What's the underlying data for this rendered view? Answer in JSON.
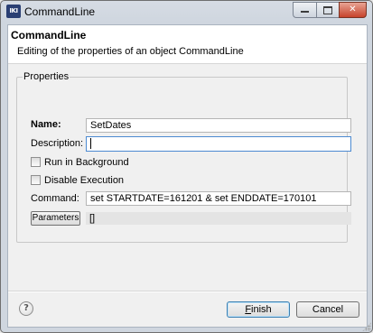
{
  "window": {
    "title": "CommandLine",
    "app_icon_text": "IKI",
    "minimize_icon": "minimize-icon",
    "maximize_icon": "maximize-icon",
    "close_glyph": "✕",
    "close_icon": "close-icon"
  },
  "header": {
    "title": "CommandLine",
    "description": "Editing of the properties of an object CommandLine"
  },
  "properties": {
    "group_label": "Properties",
    "name_label": "Name:",
    "name_value": "SetDates",
    "description_label": "Description:",
    "description_value": "",
    "run_in_background_label": "Run in Background",
    "run_in_background_checked": false,
    "disable_execution_label": "Disable Execution",
    "disable_execution_checked": false,
    "command_label": "Command:",
    "command_value": "set STARTDATE=161201 & set ENDDATE=170101",
    "parameters_button": "Parameters",
    "parameters_value": "[]"
  },
  "footer": {
    "help_icon": "help-icon",
    "help_glyph": "?",
    "finish_label_first": "F",
    "finish_label_rest": "inish",
    "cancel_label": "Cancel"
  },
  "colors": {
    "title_bar": "#cfd6df",
    "client_bg": "#f0f0f0",
    "focus_border": "#4c8ad1",
    "close_button": "#c7432b"
  }
}
